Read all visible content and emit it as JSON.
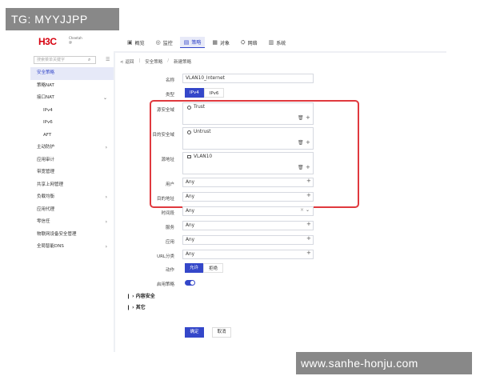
{
  "watermarks": {
    "top_left": "TG: MYYJJPP",
    "bottom_right": "www.sanhe-honju.com"
  },
  "brand": {
    "logo": "H3C",
    "sub": "Cheetah\n@"
  },
  "topnav": [
    {
      "icon": "overview-icon",
      "glyph": "▣",
      "label": "概览"
    },
    {
      "icon": "monitor-icon",
      "glyph": "◎",
      "label": "监控"
    },
    {
      "icon": "policy-icon",
      "glyph": "▤",
      "label": "策略",
      "active": true
    },
    {
      "icon": "object-icon",
      "glyph": "▦",
      "label": "对象"
    },
    {
      "icon": "network-icon",
      "glyph": "⛭",
      "label": "网络"
    },
    {
      "icon": "system-icon",
      "glyph": "▥",
      "label": "系统"
    }
  ],
  "sidebar": {
    "search_placeholder": "搜索菜单关键字",
    "items": [
      {
        "label": "安全策略",
        "active": true
      },
      {
        "label": "策略NAT"
      },
      {
        "label": "接口NAT",
        "arrow": "⌄"
      },
      {
        "label": "IPv4",
        "sub": true
      },
      {
        "label": "IPv6",
        "sub": true
      },
      {
        "label": "AFT",
        "sub": true
      },
      {
        "label": "主动防护",
        "arrow": "›"
      },
      {
        "label": "应用审计"
      },
      {
        "label": "带宽管理"
      },
      {
        "label": "共享上网管理"
      },
      {
        "label": "负载均衡",
        "arrow": "›"
      },
      {
        "label": "应用代理"
      },
      {
        "label": "零信任",
        "arrow": "›"
      },
      {
        "label": "物联网设备安全管理"
      },
      {
        "label": "全局智能DNS",
        "arrow": "›"
      }
    ]
  },
  "breadcrumb": {
    "back": "< 返回",
    "sep": "|",
    "level1": "安全策略",
    "sep2": "/",
    "level2": "新建策略"
  },
  "form": {
    "name_label": "名称",
    "name_value": "VLAN10_Internet",
    "type_label": "类型",
    "type_opt1": "IPv4",
    "type_opt2": "IPv6",
    "src_zone_label": "源安全域",
    "src_zone_value": "Trust",
    "dst_zone_label": "目的安全域",
    "dst_zone_value": "Untrust",
    "src_addr_label": "源地址",
    "src_addr_value": "VLAN10",
    "user_label": "用户",
    "user_value": "Any",
    "dst_addr_label": "目的地址",
    "dst_addr_value": "Any",
    "time_label": "时间段",
    "time_value": "Any",
    "service_label": "服务",
    "service_value": "Any",
    "app_label": "应用",
    "app_value": "Any",
    "url_label": "URL分类",
    "url_value": "Any",
    "action_label": "动作",
    "action_opt1": "允许",
    "action_opt2": "拒绝",
    "enable_label": "启用策略"
  },
  "sections": {
    "content_security": "内容安全",
    "other": "其它"
  },
  "buttons": {
    "ok": "确定",
    "cancel": "取消"
  },
  "colors": {
    "accent": "#3447c9",
    "highlight": "#e0393e",
    "brand": "#d7000f"
  }
}
